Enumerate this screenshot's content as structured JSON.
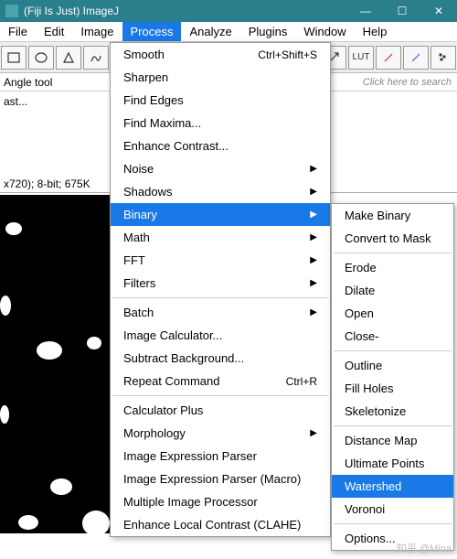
{
  "window": {
    "title": "(Fiji Is Just) ImageJ"
  },
  "menubar": {
    "file": "File",
    "edit": "Edit",
    "image": "Image",
    "process": "Process",
    "analyze": "Analyze",
    "plugins": "Plugins",
    "window": "Window",
    "help": "Help"
  },
  "toolbar": {
    "status": "Angle tool",
    "search_placeholder": "Click here to search",
    "lut_label": "LUT"
  },
  "image_window": {
    "partial_title": "ast...",
    "info": "x720); 8-bit; 675K"
  },
  "process_menu": {
    "smooth": "Smooth",
    "smooth_sc": "Ctrl+Shift+S",
    "sharpen": "Sharpen",
    "find_edges": "Find Edges",
    "find_maxima": "Find Maxima...",
    "enhance_contrast": "Enhance Contrast...",
    "noise": "Noise",
    "shadows": "Shadows",
    "binary": "Binary",
    "math": "Math",
    "fft": "FFT",
    "filters": "Filters",
    "batch": "Batch",
    "image_calculator": "Image Calculator...",
    "subtract_background": "Subtract Background...",
    "repeat_command": "Repeat Command",
    "repeat_sc": "Ctrl+R",
    "calculator_plus": "Calculator Plus",
    "morphology": "Morphology",
    "iep": "Image Expression Parser",
    "iepm": "Image Expression Parser (Macro)",
    "mip": "Multiple Image Processor",
    "clahe": "Enhance Local Contrast (CLAHE)"
  },
  "binary_menu": {
    "make_binary": "Make Binary",
    "convert_to_mask": "Convert to Mask",
    "erode": "Erode",
    "dilate": "Dilate",
    "open": "Open",
    "close": "Close-",
    "outline": "Outline",
    "fill_holes": "Fill Holes",
    "skeletonize": "Skeletonize",
    "distance_map": "Distance Map",
    "ultimate_points": "Ultimate Points",
    "watershed": "Watershed",
    "voronoi": "Voronoi",
    "options": "Options..."
  },
  "watermark": "知乎 @Mina"
}
